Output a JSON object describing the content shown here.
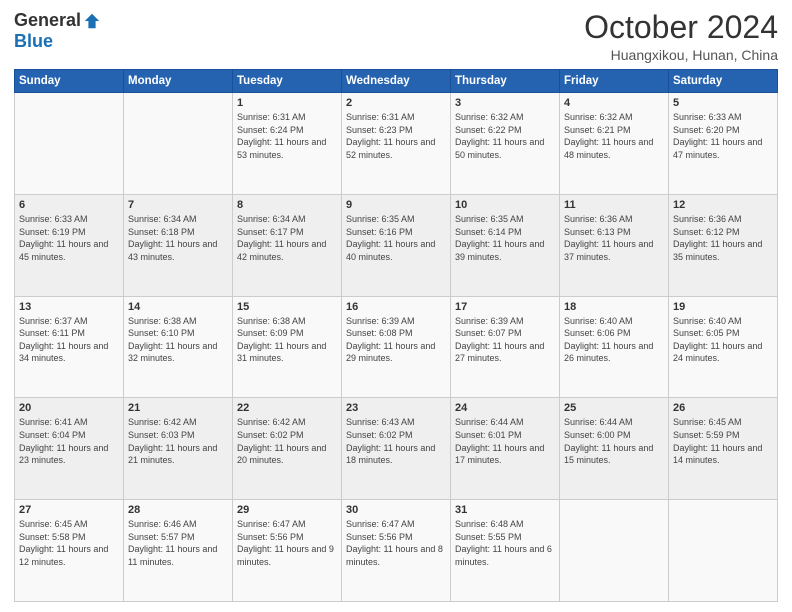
{
  "header": {
    "logo_general": "General",
    "logo_blue": "Blue",
    "month_title": "October 2024",
    "location": "Huangxikou, Hunan, China"
  },
  "days_of_week": [
    "Sunday",
    "Monday",
    "Tuesday",
    "Wednesday",
    "Thursday",
    "Friday",
    "Saturday"
  ],
  "weeks": [
    [
      {
        "day": "",
        "info": ""
      },
      {
        "day": "",
        "info": ""
      },
      {
        "day": "1",
        "info": "Sunrise: 6:31 AM\nSunset: 6:24 PM\nDaylight: 11 hours and 53 minutes."
      },
      {
        "day": "2",
        "info": "Sunrise: 6:31 AM\nSunset: 6:23 PM\nDaylight: 11 hours and 52 minutes."
      },
      {
        "day": "3",
        "info": "Sunrise: 6:32 AM\nSunset: 6:22 PM\nDaylight: 11 hours and 50 minutes."
      },
      {
        "day": "4",
        "info": "Sunrise: 6:32 AM\nSunset: 6:21 PM\nDaylight: 11 hours and 48 minutes."
      },
      {
        "day": "5",
        "info": "Sunrise: 6:33 AM\nSunset: 6:20 PM\nDaylight: 11 hours and 47 minutes."
      }
    ],
    [
      {
        "day": "6",
        "info": "Sunrise: 6:33 AM\nSunset: 6:19 PM\nDaylight: 11 hours and 45 minutes."
      },
      {
        "day": "7",
        "info": "Sunrise: 6:34 AM\nSunset: 6:18 PM\nDaylight: 11 hours and 43 minutes."
      },
      {
        "day": "8",
        "info": "Sunrise: 6:34 AM\nSunset: 6:17 PM\nDaylight: 11 hours and 42 minutes."
      },
      {
        "day": "9",
        "info": "Sunrise: 6:35 AM\nSunset: 6:16 PM\nDaylight: 11 hours and 40 minutes."
      },
      {
        "day": "10",
        "info": "Sunrise: 6:35 AM\nSunset: 6:14 PM\nDaylight: 11 hours and 39 minutes."
      },
      {
        "day": "11",
        "info": "Sunrise: 6:36 AM\nSunset: 6:13 PM\nDaylight: 11 hours and 37 minutes."
      },
      {
        "day": "12",
        "info": "Sunrise: 6:36 AM\nSunset: 6:12 PM\nDaylight: 11 hours and 35 minutes."
      }
    ],
    [
      {
        "day": "13",
        "info": "Sunrise: 6:37 AM\nSunset: 6:11 PM\nDaylight: 11 hours and 34 minutes."
      },
      {
        "day": "14",
        "info": "Sunrise: 6:38 AM\nSunset: 6:10 PM\nDaylight: 11 hours and 32 minutes."
      },
      {
        "day": "15",
        "info": "Sunrise: 6:38 AM\nSunset: 6:09 PM\nDaylight: 11 hours and 31 minutes."
      },
      {
        "day": "16",
        "info": "Sunrise: 6:39 AM\nSunset: 6:08 PM\nDaylight: 11 hours and 29 minutes."
      },
      {
        "day": "17",
        "info": "Sunrise: 6:39 AM\nSunset: 6:07 PM\nDaylight: 11 hours and 27 minutes."
      },
      {
        "day": "18",
        "info": "Sunrise: 6:40 AM\nSunset: 6:06 PM\nDaylight: 11 hours and 26 minutes."
      },
      {
        "day": "19",
        "info": "Sunrise: 6:40 AM\nSunset: 6:05 PM\nDaylight: 11 hours and 24 minutes."
      }
    ],
    [
      {
        "day": "20",
        "info": "Sunrise: 6:41 AM\nSunset: 6:04 PM\nDaylight: 11 hours and 23 minutes."
      },
      {
        "day": "21",
        "info": "Sunrise: 6:42 AM\nSunset: 6:03 PM\nDaylight: 11 hours and 21 minutes."
      },
      {
        "day": "22",
        "info": "Sunrise: 6:42 AM\nSunset: 6:02 PM\nDaylight: 11 hours and 20 minutes."
      },
      {
        "day": "23",
        "info": "Sunrise: 6:43 AM\nSunset: 6:02 PM\nDaylight: 11 hours and 18 minutes."
      },
      {
        "day": "24",
        "info": "Sunrise: 6:44 AM\nSunset: 6:01 PM\nDaylight: 11 hours and 17 minutes."
      },
      {
        "day": "25",
        "info": "Sunrise: 6:44 AM\nSunset: 6:00 PM\nDaylight: 11 hours and 15 minutes."
      },
      {
        "day": "26",
        "info": "Sunrise: 6:45 AM\nSunset: 5:59 PM\nDaylight: 11 hours and 14 minutes."
      }
    ],
    [
      {
        "day": "27",
        "info": "Sunrise: 6:45 AM\nSunset: 5:58 PM\nDaylight: 11 hours and 12 minutes."
      },
      {
        "day": "28",
        "info": "Sunrise: 6:46 AM\nSunset: 5:57 PM\nDaylight: 11 hours and 11 minutes."
      },
      {
        "day": "29",
        "info": "Sunrise: 6:47 AM\nSunset: 5:56 PM\nDaylight: 11 hours and 9 minutes."
      },
      {
        "day": "30",
        "info": "Sunrise: 6:47 AM\nSunset: 5:56 PM\nDaylight: 11 hours and 8 minutes."
      },
      {
        "day": "31",
        "info": "Sunrise: 6:48 AM\nSunset: 5:55 PM\nDaylight: 11 hours and 6 minutes."
      },
      {
        "day": "",
        "info": ""
      },
      {
        "day": "",
        "info": ""
      }
    ]
  ]
}
